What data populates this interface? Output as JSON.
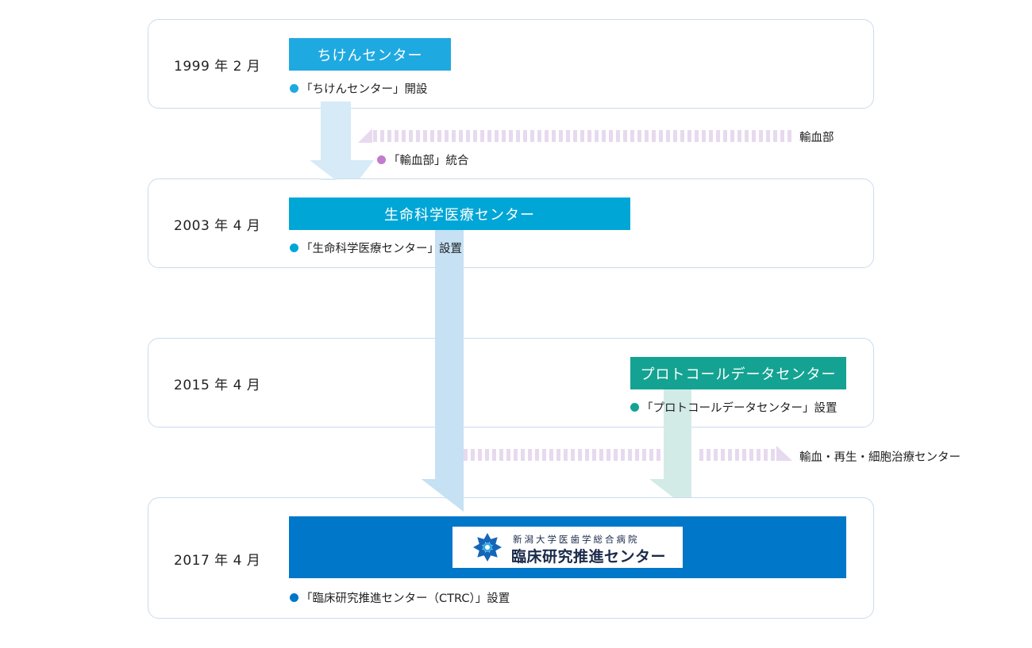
{
  "colors": {
    "chiken": "#1fa9e1",
    "seimei": "#00a6d6",
    "protocol": "#14a392",
    "ctrc": "#0077c8",
    "transfusion": "#c27bcd",
    "box_border": "#c9dcee",
    "arrow_blue": "#c5e1f3",
    "arrow_green": "#cfe9e6",
    "dash_purple": "#e7d9ee"
  },
  "stages": [
    {
      "year": "1999 年 2 月",
      "bar_label": "ちけんセンター",
      "note": "「ちけんセンター」開設"
    },
    {
      "year": "2003 年 4 月",
      "bar_label": "生命科学医療センター",
      "note": "「生命科学医療センター」設置"
    },
    {
      "year": "2015 年 4 月",
      "bar_label": "プロトコールデータセンター",
      "note": "「プロトコールデータセンター」設置"
    },
    {
      "year": "2017 年 4 月",
      "bar_label": "",
      "note": "「臨床研究推進センター（CTRC）」設置"
    }
  ],
  "merge_in": {
    "label": "輸血部",
    "note": "「輸血部」統合"
  },
  "split_out": {
    "label": "輸血・再生・細胞治療センター"
  },
  "logo": {
    "subtitle": "新潟大学医歯学総合病院",
    "title": "臨床研究推進センター",
    "icon": "ctrc-logo-icon"
  }
}
